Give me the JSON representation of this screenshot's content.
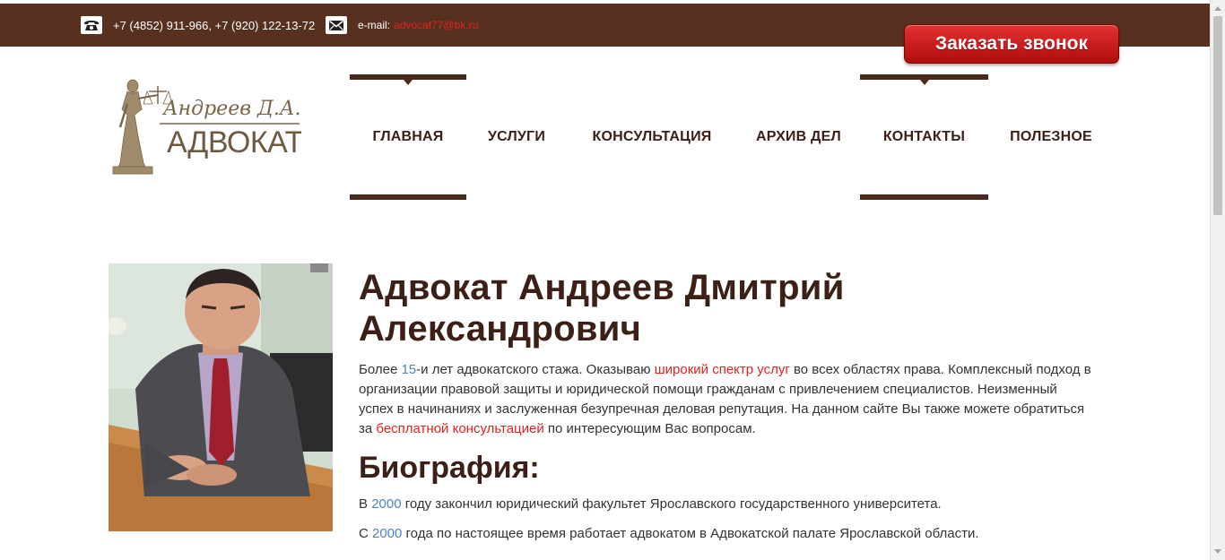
{
  "topbar": {
    "phones": "+7 (4852) 911-966, +7 (920) 122-13-72",
    "email_label": "e-mail:",
    "email": "advocat77@bk.ru",
    "phone_icon": "phone-icon",
    "mail_icon": "envelope-icon"
  },
  "call_button": {
    "label": "Заказать звонок"
  },
  "logo": {
    "name": "Андреев Д.А.",
    "title": "АДВОКАТ"
  },
  "nav": {
    "items": [
      {
        "label": "ГЛАВНАЯ",
        "active": true
      },
      {
        "label": "УСЛУГИ",
        "active": false
      },
      {
        "label": "КОНСУЛЬТАЦИЯ",
        "active": false
      },
      {
        "label": "АРХИВ ДЕЛ",
        "active": false
      },
      {
        "label": "КОНТАКТЫ",
        "active": true
      },
      {
        "label": "ПОЛЕЗНОЕ",
        "active": false
      }
    ]
  },
  "main": {
    "heading": "Адвокат Андреев Дмитрий Александрович",
    "intro": {
      "t1": "Более ",
      "years": "15",
      "t2": "-и лет адвокатского стажа. Оказываю ",
      "link1": "широкий спектр услуг",
      "t3": " во всех областях права. Комплексный подход в организации правовой защиты и юридической помощи гражданам с привлечением специалистов. Неизменный успех в начинаниях и заслуженная безупречная деловая репутация. На данном сайте Вы также можете обратиться за ",
      "link2": "бесплатной консультацией",
      "t4": " по интересующим Вас вопросам."
    },
    "bio_heading": "Биография:",
    "bio1": {
      "t1": "В ",
      "year": "2000",
      "t2": " году закончил юридический факультет Ярославского государственного университета."
    },
    "bio2": {
      "t1": "С ",
      "year": "2000",
      "t2": " года по настоящее время работает адвокатом в Адвокатской палате Ярославской области."
    }
  },
  "colors": {
    "topbar": "#58301f",
    "accent_red": "#e0241f",
    "heading_brown": "#3a2016",
    "number_blue": "#4e84c2"
  }
}
